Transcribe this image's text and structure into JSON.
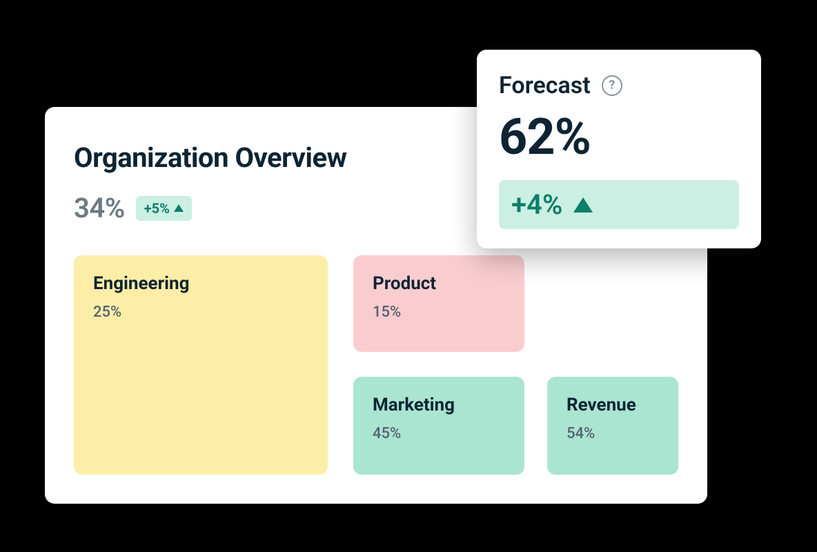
{
  "overview": {
    "title": "Organization Overview",
    "percent": "34%",
    "trend_label": "+5%"
  },
  "tiles": {
    "engineering": {
      "name": "Engineering",
      "percent": "25%"
    },
    "product": {
      "name": "Product",
      "percent": "15%"
    },
    "marketing": {
      "name": "Marketing",
      "percent": "45%"
    },
    "revenue": {
      "name": "Revenue",
      "percent": "54%"
    }
  },
  "forecast": {
    "title": "Forecast",
    "value": "62%",
    "trend_label": "+4%"
  },
  "colors": {
    "yellow": "#fdeea7",
    "pink": "#f9cdd0",
    "mint": "#a9e5d1",
    "badge_bg": "#ccefe3",
    "badge_fg": "#0b7f67"
  }
}
